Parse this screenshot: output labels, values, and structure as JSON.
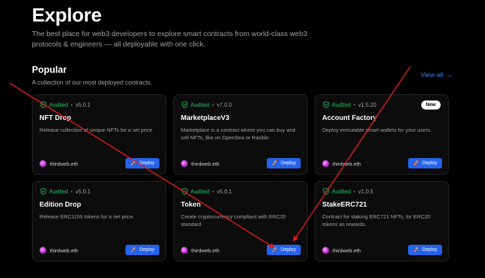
{
  "hero": {
    "title": "Explore",
    "subtitle": "The best place for web3 developers to explore smart contracts from world-class web3 protocols & engineers — all deployable with one click."
  },
  "section": {
    "title": "Popular",
    "subtitle": "A collection of our most deployed contracts.",
    "view_all": "View all",
    "view_all_arrow": "→"
  },
  "cards": [
    {
      "audited": "Audited",
      "dot": "•",
      "version": "v5.0.1",
      "name": "NFT Drop",
      "desc": "Release collection of unique NFTs for a set price",
      "author": "thirdweb.eth",
      "deploy": "Deploy"
    },
    {
      "audited": "Audited",
      "dot": "•",
      "version": "v7.0.0",
      "name": "MarketplaceV3",
      "desc": "Marketplace is a contract where you can buy and sell NFTs, like on OpenSea or Rarible.",
      "author": "thirdweb.eth",
      "deploy": "Deploy"
    },
    {
      "audited": "Audited",
      "dot": "•",
      "version": "v1.5.20",
      "name": "Account Factory",
      "desc": "Deploy immutable smart wallets for your users.",
      "author": "thirdweb.eth",
      "deploy": "Deploy",
      "badge": "New"
    },
    {
      "audited": "Audited",
      "dot": "•",
      "version": "v5.0.1",
      "name": "Edition Drop",
      "desc": "Release ERC1155 tokens for a set price.",
      "author": "thirdweb.eth",
      "deploy": "Deploy"
    },
    {
      "audited": "Audited",
      "dot": "•",
      "version": "v5.0.1",
      "name": "Token",
      "desc": "Create cryptocurrency compliant with ERC20 standard",
      "author": "thirdweb.eth",
      "deploy": "Deploy"
    },
    {
      "audited": "Audited",
      "dot": "•",
      "version": "v1.0.5",
      "name": "StakeERC721",
      "desc": "Contract for staking ERC721 NFTs, for ERC20 tokens as rewards.",
      "author": "thirdweb.eth",
      "deploy": "Deploy"
    }
  ],
  "colors": {
    "accent": "#2563eb",
    "audited": "#22c55e",
    "annotation": "#e11d1d"
  },
  "icons": {
    "audited": "shield-check-icon",
    "deploy": "rocket-icon",
    "author": "avatar-icon",
    "view_all": "arrow-right-icon"
  }
}
